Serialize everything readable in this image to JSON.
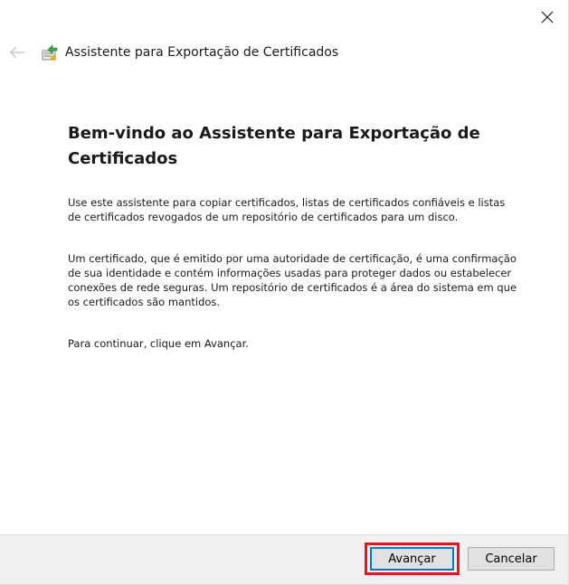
{
  "window": {
    "title": "Assistente para Exportação de Certificados",
    "icons": {
      "back": "back-arrow-icon",
      "wizard": "certificate-export-icon",
      "close": "close-icon"
    }
  },
  "content": {
    "heading": "Bem-vindo ao Assistente para Exportação de Certificados",
    "paragraphs": [
      "Use este assistente para copiar certificados, listas de certificados confiáveis e listas de certificados revogados de um repositório de certificados para um disco.",
      "Um certificado, que é emitido por uma autoridade de certificação, é uma confirmação de sua identidade e contém informações usadas para proteger dados ou estabelecer conexões de rede seguras. Um repositório de certificados é a área do sistema em que os certificados são mantidos.",
      "Para continuar, clique em Avançar."
    ]
  },
  "footer": {
    "next_label": "Avançar",
    "cancel_label": "Cancelar"
  },
  "colors": {
    "highlight": "#e8141c",
    "focus": "#0078d7",
    "footer_bg": "#f0f0f0"
  }
}
